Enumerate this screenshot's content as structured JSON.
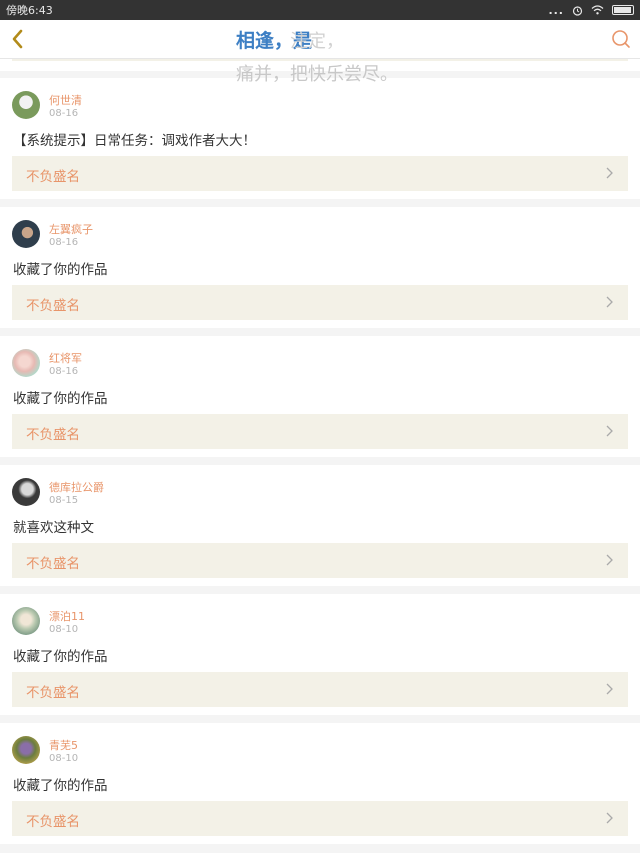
{
  "status": {
    "time": "傍晚6:43",
    "dots": "..."
  },
  "header": {
    "title": "相逢，是",
    "overlay_line1": "注定，",
    "overlay_line2": "痛并，把快乐尝尽。"
  },
  "notifications": [
    {
      "user": "何世清",
      "date": "08-16",
      "message": "【系统提示】日常任务：调戏作者大大！",
      "work": "不负盛名",
      "avatar_color": "#7a9a5c"
    },
    {
      "user": "左翼疯子",
      "date": "08-16",
      "message": "收藏了你的作品",
      "work": "不负盛名",
      "avatar_color": "#2f3e4c"
    },
    {
      "user": "红将军",
      "date": "08-16",
      "message": "收藏了你的作品",
      "work": "不负盛名",
      "avatar_color": "#e7b9b3"
    },
    {
      "user": "德库拉公爵",
      "date": "08-15",
      "message": "就喜欢这种文",
      "work": "不负盛名",
      "avatar_color": "#3a3a3a"
    },
    {
      "user": "漂泊11",
      "date": "08-10",
      "message": "收藏了你的作品",
      "work": "不负盛名",
      "avatar_color": "#b9c9b0"
    },
    {
      "user": "青芜5",
      "date": "08-10",
      "message": "收藏了你的作品",
      "work": "不负盛名",
      "avatar_color": "#6b7d3e"
    }
  ],
  "colors": {
    "accent": "#e8956a",
    "title": "#3d7fc4",
    "work_bg": "#f3f1e7"
  }
}
